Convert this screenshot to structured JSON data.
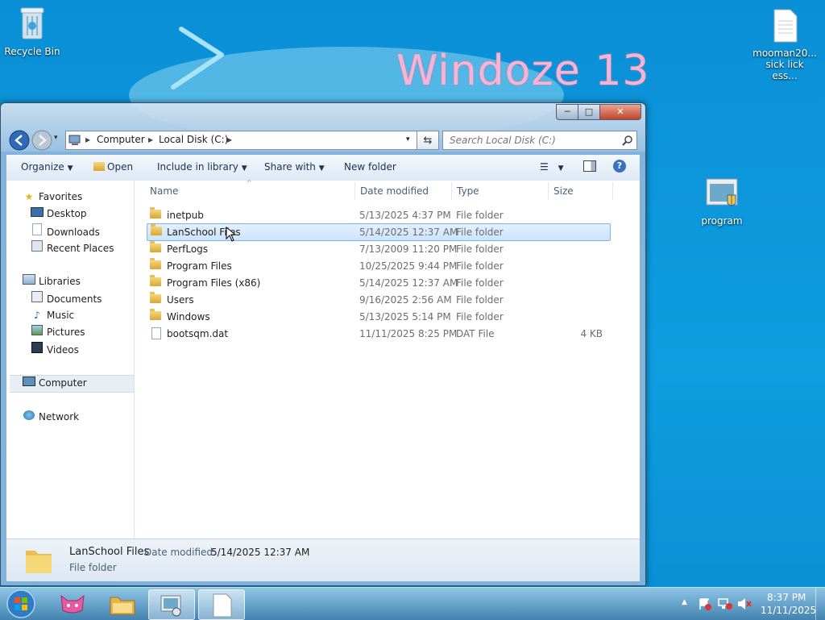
{
  "desktop": {
    "wallpaper_text": "Windoze 13",
    "icons": {
      "recycle_bin": "Recycle Bin",
      "text_file_line1": "mooman20...",
      "text_file_line2": "sick lick ess...",
      "program": "program"
    }
  },
  "window": {
    "address": {
      "crumbs": [
        "Computer",
        "Local Disk (C:)"
      ]
    },
    "search_placeholder": "Search Local Disk (C:)",
    "toolbar": {
      "organize": "Organize",
      "open": "Open",
      "include_in_library": "Include in library",
      "share_with": "Share with",
      "new_folder": "New folder"
    },
    "nav": {
      "favorites": {
        "label": "Favorites",
        "items": [
          "Desktop",
          "Downloads",
          "Recent Places"
        ]
      },
      "libraries": {
        "label": "Libraries",
        "items": [
          "Documents",
          "Music",
          "Pictures",
          "Videos"
        ]
      },
      "computer": "Computer",
      "network": "Network"
    },
    "columns": {
      "name": "Name",
      "date": "Date modified",
      "type": "Type",
      "size": "Size"
    },
    "files": [
      {
        "name": "inetpub",
        "date": "5/13/2025 4:37 PM",
        "type": "File folder",
        "size": ""
      },
      {
        "name": "LanSchool Files",
        "date": "5/14/2025 12:37 AM",
        "type": "File folder",
        "size": ""
      },
      {
        "name": "PerfLogs",
        "date": "7/13/2009 11:20 PM",
        "type": "File folder",
        "size": ""
      },
      {
        "name": "Program Files",
        "date": "10/25/2025 9:44 PM",
        "type": "File folder",
        "size": ""
      },
      {
        "name": "Program Files (x86)",
        "date": "5/14/2025 12:37 AM",
        "type": "File folder",
        "size": ""
      },
      {
        "name": "Users",
        "date": "9/16/2025 2:56 AM",
        "type": "File folder",
        "size": ""
      },
      {
        "name": "Windows",
        "date": "5/13/2025 5:14 PM",
        "type": "File folder",
        "size": ""
      },
      {
        "name": "bootsqm.dat",
        "date": "11/11/2025 8:25 PM",
        "type": "DAT File",
        "size": "4 KB"
      }
    ],
    "details": {
      "name": "LanSchool Files",
      "date_label": "Date modified:",
      "date": "5/14/2025 12:37 AM",
      "type": "File folder"
    }
  },
  "taskbar": {
    "time": "8:37 PM",
    "date": "11/11/2025",
    "tray_arrow": "▲"
  },
  "colors": {
    "accent": "#0a8fd6",
    "selection": "#cbe4fb",
    "wallpaper_text": "#f7b3d3"
  }
}
